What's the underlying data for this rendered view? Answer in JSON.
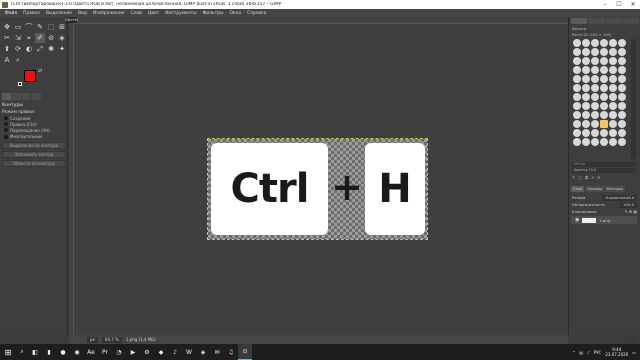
{
  "window": {
    "title": "[Ctrl (импортировано)]-3.0 (Цвета RGB 8 бит, нелинейная целочисленная, GIMP built-in sRGB, 1 слой) 364x157 – GIMP",
    "minimize": "–",
    "maximize": "☐",
    "close": "✕"
  },
  "menubar": {
    "items": [
      "Файл",
      "Правка",
      "Выделение",
      "Вид",
      "Изображение",
      "Слой",
      "Цвет",
      "Инструменты",
      "Фильтры",
      "Окна",
      "Справка"
    ]
  },
  "toolbox": {
    "tools": [
      "✥",
      "▭",
      "⌒",
      "✎",
      "⬚",
      "⊞",
      "✂",
      "⇲",
      "⌖",
      "✐",
      "⊘",
      "◈",
      "⬆",
      "⟳",
      "◐",
      "⤢",
      "✺",
      "✦",
      "A",
      "⌕"
    ],
    "options_title": "Контуры",
    "mode_label": "Режим правки:",
    "mode_options": [
      "Создание",
      "Правка (Ctrl)",
      "Перемещение (Alt)"
    ],
    "polygonal_label": "Многоугольник",
    "buttons": [
      "Выделение из контура",
      "Заполнить контур",
      "Обвести по контуру"
    ]
  },
  "canvas": {
    "zoom_badge": "Ctrl+H",
    "key_ctrl": "Ctrl",
    "plus": "+",
    "key_h": "H"
  },
  "statusbar": {
    "unit": "px",
    "zoom": "66,7 %",
    "info": "1.png (1,4 МБ)"
  },
  "brushes": {
    "filter": "Фильтр",
    "name": "Pencil 02 (100 × 100)",
    "tags_placeholder": "Метки",
    "slider_label": "Spacing",
    "slider_value": "10,0"
  },
  "layers": {
    "tabs": [
      "Слои",
      "Каналы",
      "Контуры"
    ],
    "mode_label": "Режим",
    "mode_value": "Нормальный ▾",
    "opacity_label": "Непрозрачность",
    "opacity_value": "100,0",
    "lock_label": "Блокировка:",
    "layer_name": "1.png"
  },
  "taskbar": {
    "start": "⊞",
    "search": "⌕",
    "apps": [
      "◧",
      "▮",
      "●",
      "◉",
      "Ae",
      "Pr",
      "◔",
      "▶",
      "⚙",
      "◆",
      "♪",
      "W",
      "◈",
      "✉",
      "♫",
      "⊙"
    ],
    "lang": "РУС",
    "time": "9:44",
    "date": "23.07.2020"
  }
}
